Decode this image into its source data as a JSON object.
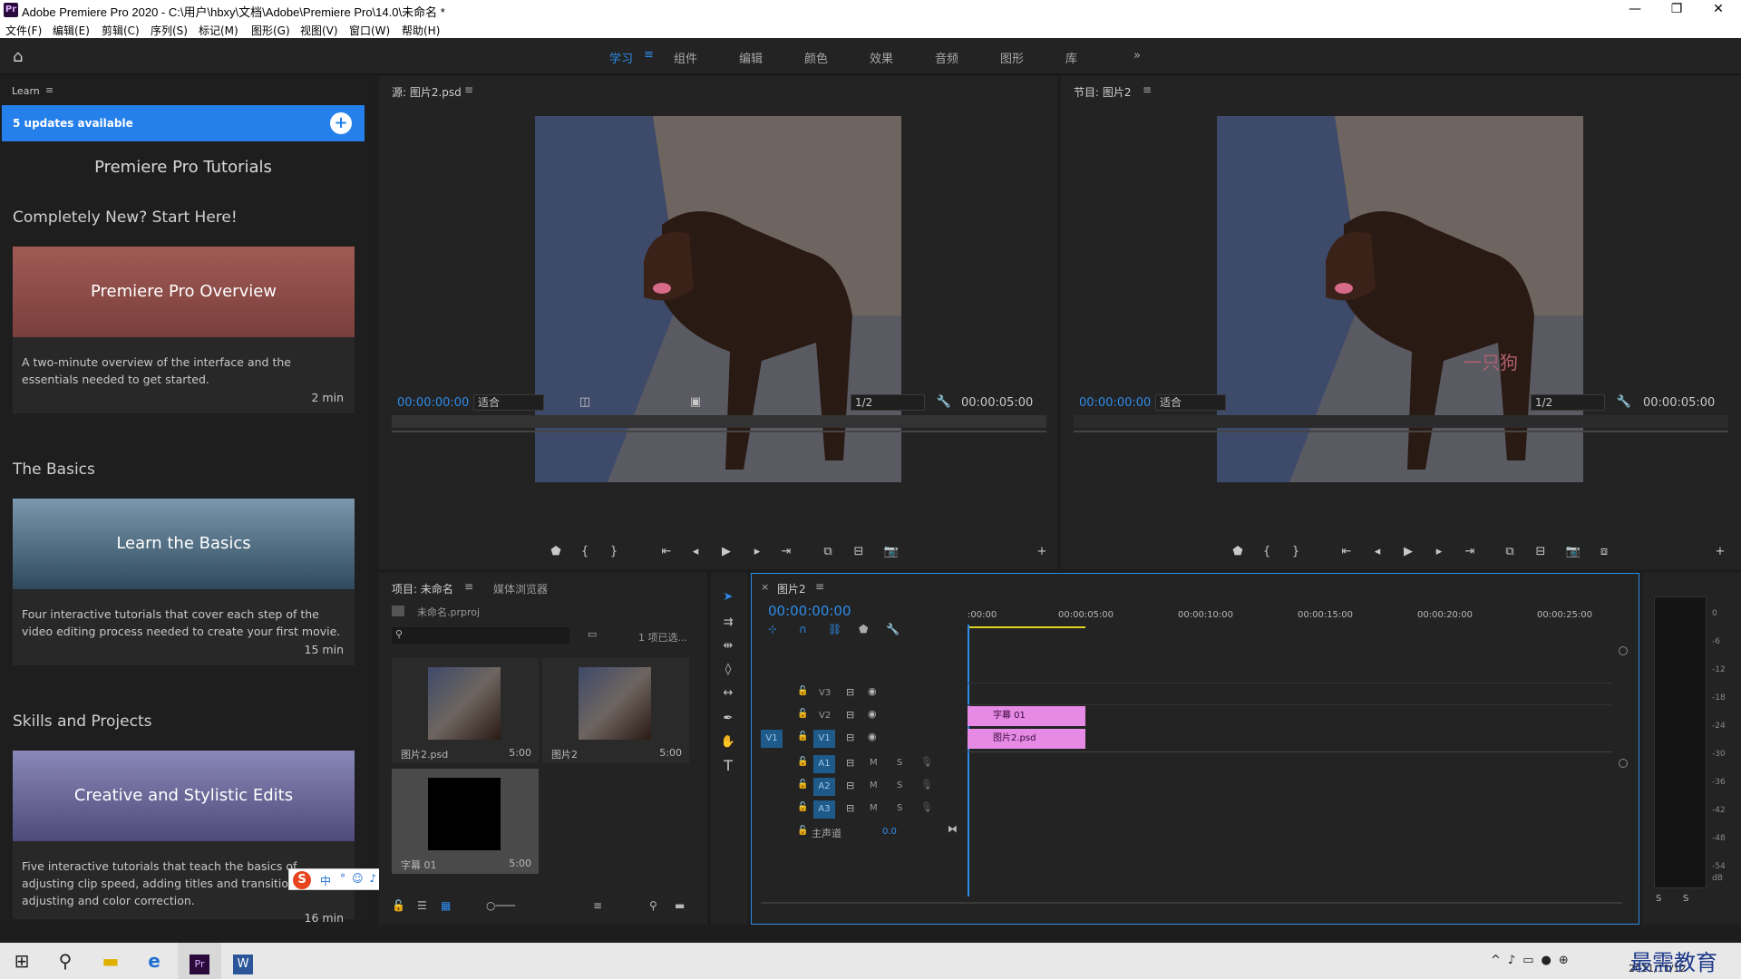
{
  "window": {
    "title": "Adobe Premiere Pro 2020 - C:\\用户\\hbxy\\文档\\Adobe\\Premiere Pro\\14.0\\未命名 *",
    "app_icon": "Pr",
    "controls": [
      "—",
      "❐",
      "✕"
    ]
  },
  "menu": [
    "文件(F)",
    "编辑(E)",
    "剪辑(C)",
    "序列(S)",
    "标记(M)",
    "图形(G)",
    "视图(V)",
    "窗口(W)",
    "帮助(H)"
  ],
  "workspaces": {
    "items": [
      "学习",
      "组件",
      "编辑",
      "颜色",
      "效果",
      "音频",
      "图形",
      "库"
    ],
    "active": "学习",
    "more": "»"
  },
  "learn": {
    "panel_title": "Learn",
    "updates": "5 updates available",
    "heading": "Premiere Pro Tutorials",
    "sections": [
      {
        "title": "Completely New? Start Here!",
        "card_title": "Premiere Pro Overview",
        "desc": "A two-minute overview of the interface and the essentials needed to get started.",
        "duration": "2 min"
      },
      {
        "title": "The Basics",
        "card_title": "Learn the Basics",
        "desc": "Four interactive tutorials that cover each step of the video editing process needed to create your first movie.",
        "duration": "15 min"
      },
      {
        "title": "Skills and Projects",
        "card_title": "Creative and Stylistic Edits",
        "desc": "Five interactive tutorials that teach the basics of adjusting clip speed, adding titles and transitions, adjusting and color correction.",
        "duration": "16 min"
      }
    ]
  },
  "source": {
    "title": "源: 图片2.psd",
    "timecode": "00:00:00:00",
    "fit": "适合",
    "resolution": "1/2",
    "duration": "00:00:05:00"
  },
  "program": {
    "title": "节目: 图片2",
    "timecode": "00:00:00:00",
    "fit": "适合",
    "resolution": "1/2",
    "duration": "00:00:05:00",
    "watermark": "一只狗"
  },
  "project": {
    "tab_active": "项目: 未命名",
    "tab_other": "媒体浏览器",
    "file": "未命名.prproj",
    "selected": "1 项已选...",
    "items": [
      {
        "name": "图片2.psd",
        "duration": "5:00"
      },
      {
        "name": "图片2",
        "duration": "5:00"
      },
      {
        "name": "字幕 01",
        "duration": "5:00"
      }
    ]
  },
  "timeline": {
    "tab": "图片2",
    "timecode": "00:00:00:00",
    "ruler": ":00:00",
    "ticks": [
      "00:00:05:00",
      "00:00:10:00",
      "00:00:15:00",
      "00:00:20:00",
      "00:00:25:00"
    ],
    "video_tracks": [
      "V3",
      "V2",
      "V1"
    ],
    "source_patch": "V1",
    "audio_tracks": [
      "A1",
      "A2",
      "A3"
    ],
    "audio_buttons": [
      "M",
      "S"
    ],
    "master": "主声道",
    "master_value": "0.0",
    "clips": [
      "字幕 01",
      "图片2.psd"
    ]
  },
  "meter": {
    "scale": [
      "0",
      "-6",
      "-12",
      "-18",
      "-24",
      "-30",
      "-36",
      "-42",
      "-48",
      "-54",
      "dB"
    ],
    "solo": [
      "S",
      "S"
    ]
  },
  "ime": {
    "logo": "S",
    "label": "中"
  },
  "taskbar": {
    "time": "2021/11/12",
    "watermark": "最需教育"
  }
}
